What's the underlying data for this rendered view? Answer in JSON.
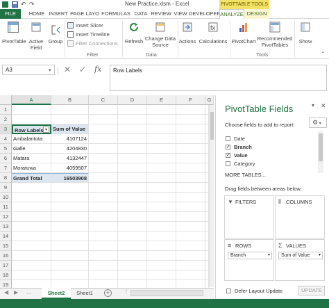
{
  "window": {
    "title": "New Practice.xlsm - Excel",
    "context_tab_title": "PIVOTTABLE TOOLS"
  },
  "tabs": [
    "FILE",
    "HOME",
    "INSERT",
    "PAGE LAYO",
    "FORMULAS",
    "DATA",
    "REVIEW",
    "VIEW",
    "DEVELOPER",
    "ANALYZE",
    "DESIGN"
  ],
  "active_tab": "ANALYZE",
  "ribbon": {
    "pivottable": "PivotTable",
    "active_field": "Active\nField",
    "group": "Group",
    "insert_slicer": "Insert Slicer",
    "insert_timeline": "Insert Timeline",
    "filter_connections": "Filter Connections",
    "filter_group": "Filter",
    "refresh": "Refresh",
    "change_data_source": "Change Data\nSource",
    "data_group": "Data",
    "actions": "Actions",
    "calculations": "Calculations",
    "pivotchart": "PivotChart",
    "recommended": "Recommended\nPivotTables",
    "tools_group": "Tools",
    "show": "Show"
  },
  "formula_bar": {
    "name_box": "A3",
    "content": "Row Labels"
  },
  "grid": {
    "columns": [
      "A",
      "B",
      "C",
      "D",
      "E",
      "F",
      "G"
    ],
    "rows": [
      "1",
      "2",
      "3",
      "4",
      "5",
      "6",
      "7",
      "8",
      "9",
      "10",
      "11",
      "12",
      "13",
      "14",
      "15",
      "16",
      "17",
      "18",
      "19"
    ],
    "pivot": {
      "header_label": "Row Labels",
      "header_value": "Sum of Value",
      "items": [
        {
          "label": "Ambalantota",
          "value": "4107124"
        },
        {
          "label": "Galle",
          "value": "4204830"
        },
        {
          "label": "Matara",
          "value": "4132447"
        },
        {
          "label": "Moratuwa",
          "value": "4059507"
        }
      ],
      "total_label": "Grand Total",
      "total_value": "16503908"
    }
  },
  "sheets": [
    "Sheet2",
    "Sheet1"
  ],
  "active_sheet": "Sheet2",
  "pivot_pane": {
    "title": "PivotTable Fields",
    "choose_text": "Choose fields to add to report:",
    "fields": [
      {
        "name": "Date",
        "checked": false
      },
      {
        "name": "Branch",
        "checked": true
      },
      {
        "name": "Value",
        "checked": true
      },
      {
        "name": "Category",
        "checked": false
      }
    ],
    "more_tables": "MORE TABLES...",
    "drag_text": "Drag fields between areas below:",
    "filters_label": "FILTERS",
    "columns_label": "COLUMNS",
    "rows_label": "ROWS",
    "values_label": "VALUES",
    "rows_item": "Branch",
    "values_item": "Sum of Value",
    "defer_label": "Defer Layout Update",
    "update_button": "UPDATE"
  },
  "colors": {
    "excel_green": "#217346",
    "context_yellow": "#f2e266",
    "pivot_header_fill": "#dce6f1"
  }
}
